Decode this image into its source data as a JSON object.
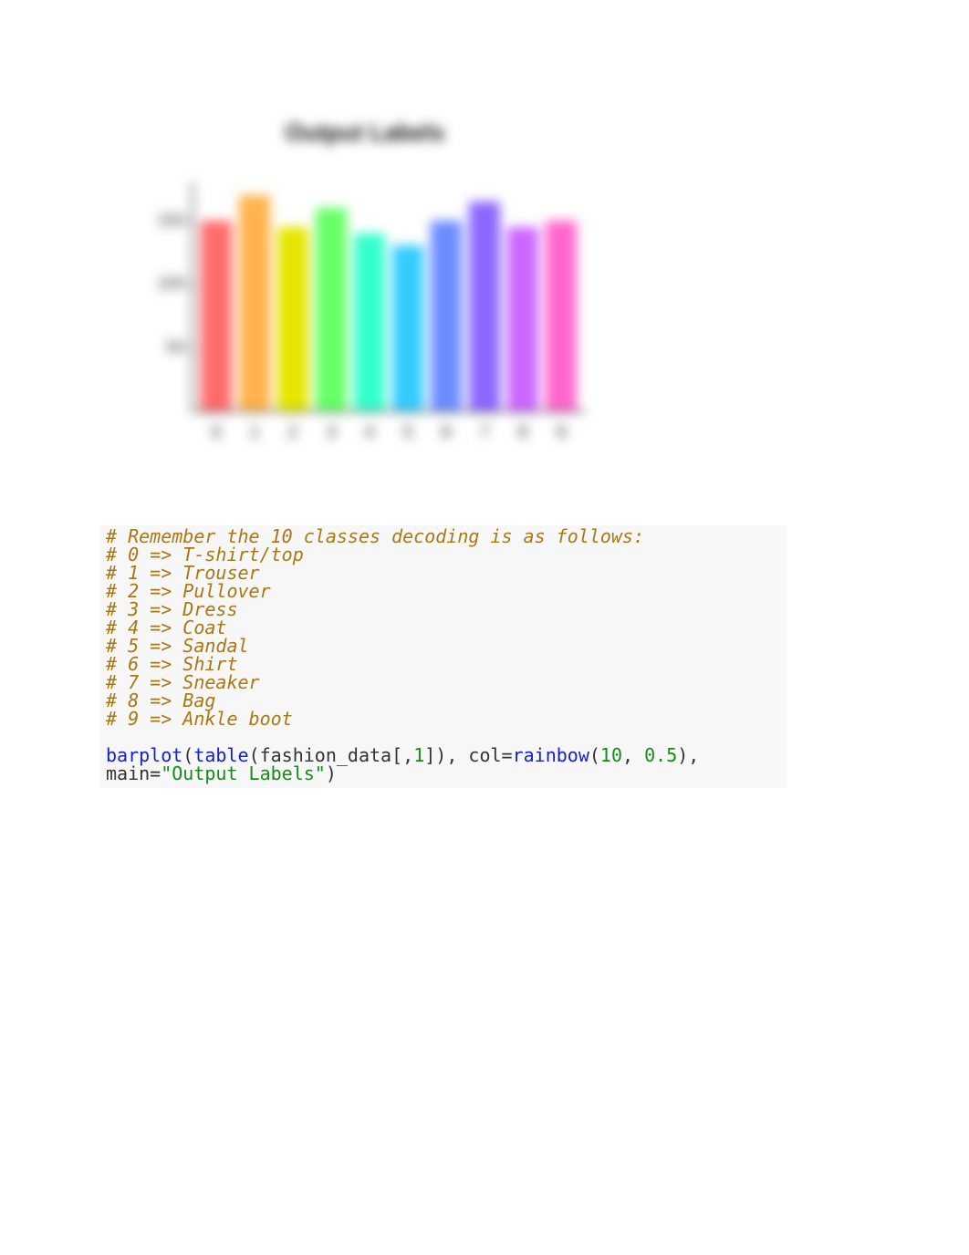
{
  "chart_data": {
    "type": "bar",
    "title": "Output Labels",
    "categories": [
      "0",
      "1",
      "2",
      "3",
      "4",
      "5",
      "6",
      "7",
      "8",
      "9"
    ],
    "values": [
      150,
      170,
      145,
      160,
      140,
      130,
      150,
      165,
      145,
      150
    ],
    "colors": [
      "#ff6b6b",
      "#ffb24d",
      "#e6e600",
      "#66ff66",
      "#33ffcc",
      "#33ccff",
      "#6b8cff",
      "#8c66ff",
      "#cc66ff",
      "#ff66cc"
    ],
    "xlabel": "",
    "ylabel": "",
    "y_ticks": [
      50,
      100,
      150
    ],
    "ylim": [
      0,
      180
    ]
  },
  "code": {
    "lines": [
      "# Remember the 10 classes decoding is as follows:",
      "# 0 => T-shirt/top",
      "# 1 => Trouser",
      "# 2 => Pullover",
      "# 3 => Dress",
      "# 4 => Coat",
      "# 5 => Sandal",
      "# 6 => Shirt",
      "# 7 => Sneaker",
      "# 8 => Bag",
      "# 9 => Ankle boot"
    ],
    "call": {
      "fn1": "barplot",
      "p_open1": "(",
      "fn2": "table",
      "p_open2": "(fashion_data[,",
      "one": "1",
      "bracket_close": "]), ",
      "col_kw": "col",
      "eq1": "=",
      "fn3": "rainbow",
      "p_open3": "(",
      "ten": "10",
      "comma2": ", ",
      "half": "0.5",
      "p_close3": "), ",
      "main_kw": "main",
      "eq2": "=",
      "str": "\"Output Labels\"",
      "p_close1": ")"
    }
  }
}
